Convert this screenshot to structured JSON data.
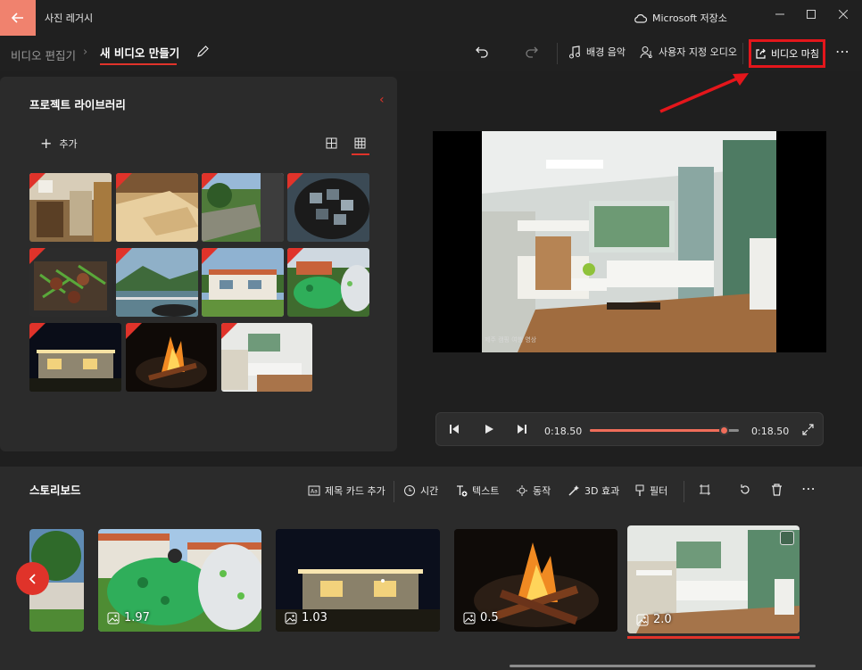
{
  "titlebar": {
    "app_title": "사진 레거시",
    "cloud_label": "Microsoft 저장소"
  },
  "tabs": {
    "breadcrumb_parent": "비디오 편집기",
    "breadcrumb_sep": "›",
    "current_tab": "새 비디오 만들기"
  },
  "toolbar": {
    "music_label": "배경 음악",
    "custom_audio_label": "사용자 지정 오디오",
    "finish_label": "비디오 마침"
  },
  "library": {
    "title": "프로젝트 라이브러리",
    "add_label": "추가"
  },
  "transport": {
    "current_time": "0:18.50",
    "end_time": "0:18.50",
    "progress_fraction": 0.9
  },
  "preview": {
    "watermark": "제주 캠핑 여행 영상"
  },
  "storyboard": {
    "title": "스토리보드",
    "tools": {
      "title_card": "제목 카드 추가",
      "duration": "시간",
      "text": "텍스트",
      "motion": "동작",
      "effects_3d": "3D 효과",
      "filter": "필터"
    },
    "clips": [
      {
        "label": "1.97"
      },
      {
        "label": "1.03"
      },
      {
        "label": "0.5"
      },
      {
        "label": "2.0"
      }
    ]
  },
  "colors": {
    "accent": "#e0332a",
    "back_button": "#f0826e",
    "highlight_box": "#e4161b"
  }
}
